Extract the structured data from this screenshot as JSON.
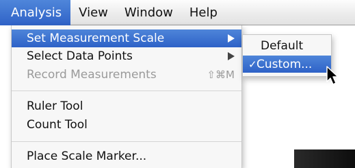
{
  "menubar": {
    "items": [
      {
        "label": "Analysis"
      },
      {
        "label": "View"
      },
      {
        "label": "Window"
      },
      {
        "label": "Help"
      }
    ]
  },
  "analysis_menu": {
    "set_scale": {
      "label": "Set Measurement Scale",
      "icon": "submenu-arrow-icon"
    },
    "select_points": {
      "label": "Select Data Points",
      "icon": "submenu-arrow-icon"
    },
    "record": {
      "label": "Record Measurements",
      "shortcut": "⇧⌘M"
    },
    "ruler": {
      "label": "Ruler Tool"
    },
    "count": {
      "label": "Count Tool"
    },
    "marker": {
      "label": "Place Scale Marker..."
    }
  },
  "scale_submenu": {
    "default": {
      "label": "Default"
    },
    "custom": {
      "label": "Custom...",
      "check": "✓"
    }
  },
  "colors": {
    "highlight": "#3a6fcf",
    "disabled_text": "#9a9a9a",
    "menu_bg": "#f7f7f7"
  }
}
